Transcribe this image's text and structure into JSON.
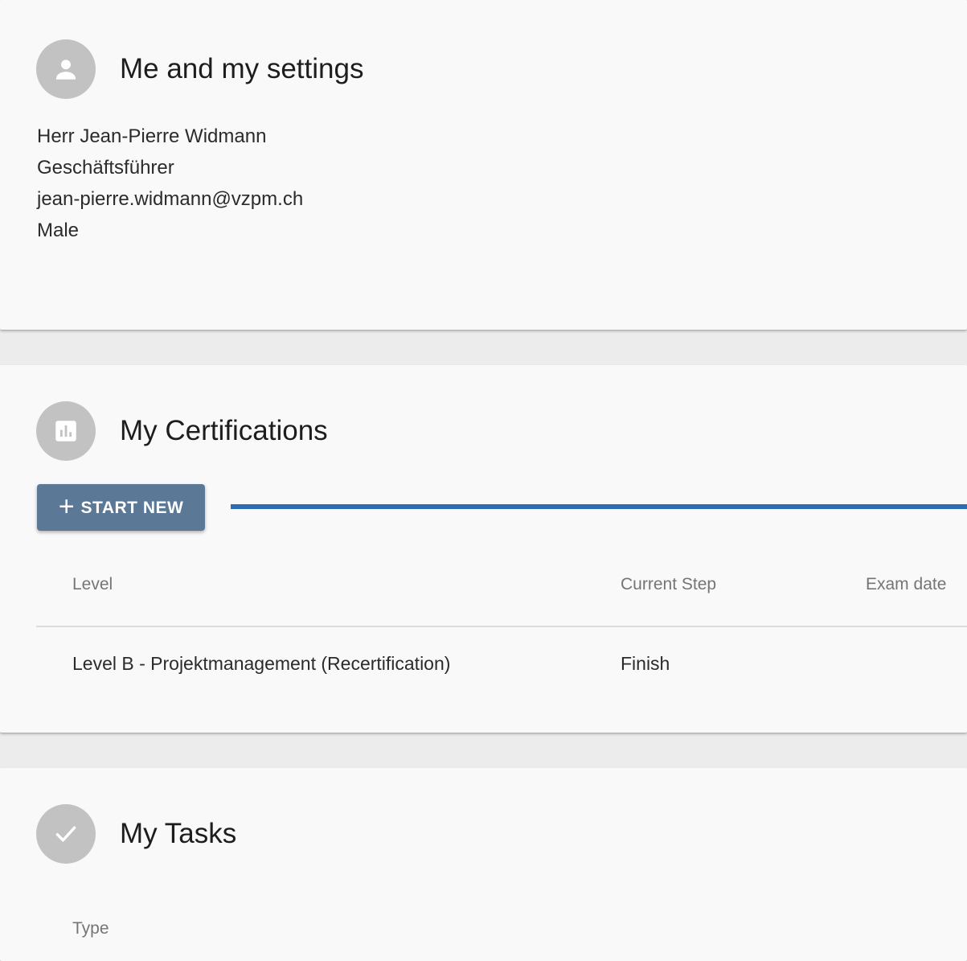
{
  "profile": {
    "title": "Me and my settings",
    "icon": "person-icon",
    "name": "Herr Jean-Pierre Widmann",
    "role": "Geschäftsführer",
    "email": "jean-pierre.widmann@vzpm.ch",
    "gender": "Male"
  },
  "certifications": {
    "title": "My Certifications",
    "icon": "bar-chart-icon",
    "start_new": {
      "plus": "+",
      "label": "START NEW"
    },
    "columns": [
      "Level",
      "Current Step",
      "Exam date"
    ],
    "rows": [
      {
        "level": "Level B - Projektmanagement (Recertification)",
        "step": "Finish",
        "exam_date": ""
      }
    ]
  },
  "tasks": {
    "title": "My Tasks",
    "icon": "check-icon",
    "columns": [
      "Type"
    ]
  },
  "colors": {
    "button": "#5b7896",
    "annotation_arrow": "#2f6db3",
    "avatar": "#c2c2c2"
  }
}
